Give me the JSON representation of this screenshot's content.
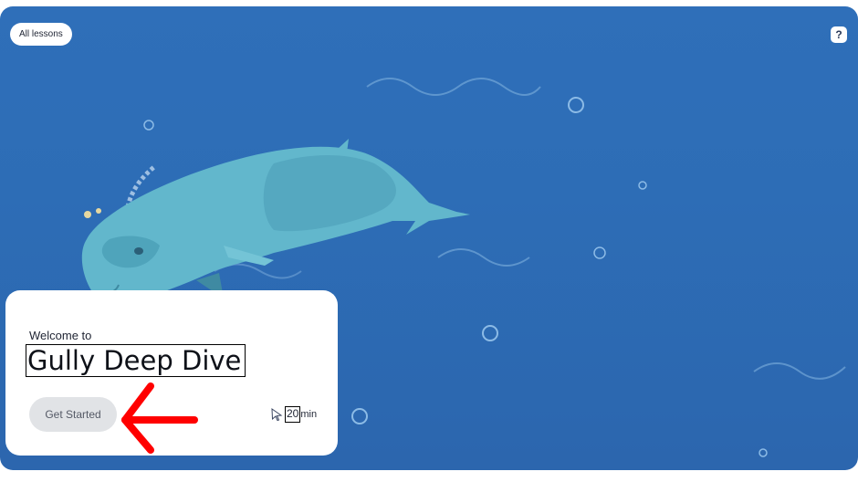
{
  "header": {
    "all_lessons_label": "All lessons",
    "help_label": "?"
  },
  "card": {
    "welcome_text": "Welcome to",
    "title": "Gully Deep Dive",
    "start_button_label": "Get Started",
    "duration_value": "20",
    "duration_unit": "min"
  },
  "colors": {
    "ocean": "#2d6db6",
    "whale": "#62b7cc",
    "arrow": "#ff0000"
  },
  "icons": [
    "help-icon",
    "cursor-icon",
    "red-arrow-icon",
    "whale-illustration"
  ]
}
